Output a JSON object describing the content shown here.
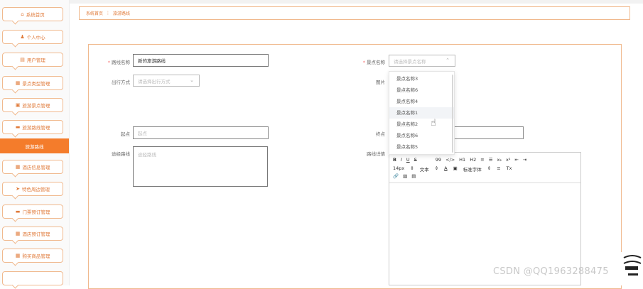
{
  "sidebar": {
    "items": [
      {
        "label": "系统首页",
        "icon": "home-icon",
        "glyph": "⌂"
      },
      {
        "label": "个人中心",
        "icon": "user-icon",
        "glyph": "♟"
      },
      {
        "label": "用户管理",
        "icon": "table-icon",
        "glyph": "▤"
      },
      {
        "label": "景点类型管理",
        "icon": "grid-icon",
        "glyph": "▦"
      },
      {
        "label": "旅游景点管理",
        "icon": "calendar-icon",
        "glyph": "▣"
      },
      {
        "label": "旅游路线管理",
        "icon": "folder-icon",
        "glyph": "▬"
      },
      {
        "label": "旅游路线",
        "icon": "",
        "glyph": "",
        "active": true
      },
      {
        "label": "酒店信息管理",
        "icon": "grid-icon",
        "glyph": "▦"
      },
      {
        "label": "特色周边管理",
        "icon": "send-icon",
        "glyph": "➤"
      },
      {
        "label": "门票预订管理",
        "icon": "card-icon",
        "glyph": "▬"
      },
      {
        "label": "酒店预订管理",
        "icon": "grid-icon",
        "glyph": "▦"
      },
      {
        "label": "购买商品管理",
        "icon": "grid-icon",
        "glyph": "▦"
      }
    ]
  },
  "breadcrumb": {
    "home": "系统首页",
    "separator": "⋮",
    "current": "旅游路线"
  },
  "form": {
    "route_name_label": "路线名称",
    "route_name_value": "新的旅游路线",
    "scenic_label": "景点名称",
    "scenic_placeholder": "请选择景点名称",
    "travel_mode_label": "出行方式",
    "travel_mode_placeholder": "请选择出行方式",
    "image_label": "图片",
    "start_label": "起点",
    "start_placeholder": "起点",
    "end_label": "终点",
    "route_detail_label": "途经路线",
    "route_detail_placeholder": "途经路线",
    "route_info_label": "路线详情"
  },
  "dropdown": {
    "options": [
      "景点名称3",
      "景点名称6",
      "景点名称4",
      "景点名称1",
      "景点名称2",
      "景点名称6",
      "景点名称5"
    ],
    "hovered_index": 3
  },
  "editor": {
    "row1": [
      "B",
      "I",
      "U",
      "S",
      "99",
      "</>",
      "H1",
      "H2",
      "≡",
      "☰",
      "x₂",
      "x²",
      "⇤",
      "⇥"
    ],
    "row2": [
      "14px",
      "⇕",
      "文本",
      "⇕",
      "A",
      "▣",
      "标准字体",
      "⇕",
      "≡",
      "Tx"
    ],
    "row3": [
      "🔗",
      "▨",
      "▤"
    ]
  },
  "watermark": "CSDN @QQ1963288475",
  "colors": {
    "accent": "#f47c2b",
    "border": "#f0b98e"
  }
}
